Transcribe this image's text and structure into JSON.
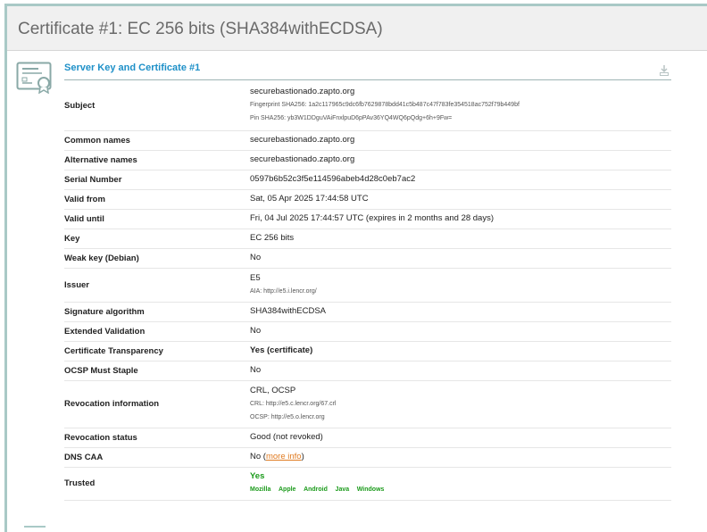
{
  "page": {
    "title": "Certificate #1: EC 256 bits (SHA384withECDSA)"
  },
  "section": {
    "title": "Server Key and Certificate #1",
    "download_icon": "download-icon",
    "cert_icon": "certificate-icon"
  },
  "rows": {
    "subject": {
      "label": "Subject",
      "value": "securebastionado.zapto.org",
      "fingerprint": "Fingerprint SHA256: 1a2c117965c9dc6fb7629878bdd41c5b487c47f783fe354518ac752f79b449bf",
      "pin": "Pin SHA256: yb3W1DDguVAiFnxlpuD6pPAv36YQ4WQ6pQdg+6h+9Fw="
    },
    "common_names": {
      "label": "Common names",
      "value": "securebastionado.zapto.org"
    },
    "alternative_names": {
      "label": "Alternative names",
      "value": "securebastionado.zapto.org"
    },
    "serial_number": {
      "label": "Serial Number",
      "value": "0597b6b52c3f5e114596abeb4d28c0eb7ac2"
    },
    "valid_from": {
      "label": "Valid from",
      "value": "Sat, 05 Apr 2025 17:44:58 UTC"
    },
    "valid_until": {
      "label": "Valid until",
      "value": "Fri, 04 Jul 2025 17:44:57 UTC (expires in 2 months and 28 days)"
    },
    "key": {
      "label": "Key",
      "value": "EC 256 bits"
    },
    "weak_key": {
      "label": "Weak key (Debian)",
      "value": "No"
    },
    "issuer": {
      "label": "Issuer",
      "value": "E5",
      "aia": "AIA: http://e5.i.lencr.org/"
    },
    "signature_algorithm": {
      "label": "Signature algorithm",
      "value": "SHA384withECDSA"
    },
    "extended_validation": {
      "label": "Extended Validation",
      "value": "No"
    },
    "certificate_transparency": {
      "label": "Certificate Transparency",
      "value": "Yes (certificate)"
    },
    "ocsp_must_staple": {
      "label": "OCSP Must Staple",
      "value": "No"
    },
    "revocation_information": {
      "label": "Revocation information",
      "value": "CRL, OCSP",
      "crl": "CRL: http://e5.c.lencr.org/67.crl",
      "ocsp": "OCSP: http://e5.o.lencr.org"
    },
    "revocation_status": {
      "label": "Revocation status",
      "value": "Good (not revoked)"
    },
    "dns_caa": {
      "label": "DNS CAA",
      "value_prefix": "No (",
      "link": "more info",
      "value_suffix": ")"
    },
    "trusted": {
      "label": "Trusted",
      "value": "Yes",
      "stores": [
        "Mozilla",
        "Apple",
        "Android",
        "Java",
        "Windows"
      ]
    }
  },
  "colors": {
    "accent_blue": "#1e90c8",
    "good_green": "#1a9a1a",
    "warn_orange": "#e07a1f",
    "frame_teal": "#a9c9c6"
  }
}
